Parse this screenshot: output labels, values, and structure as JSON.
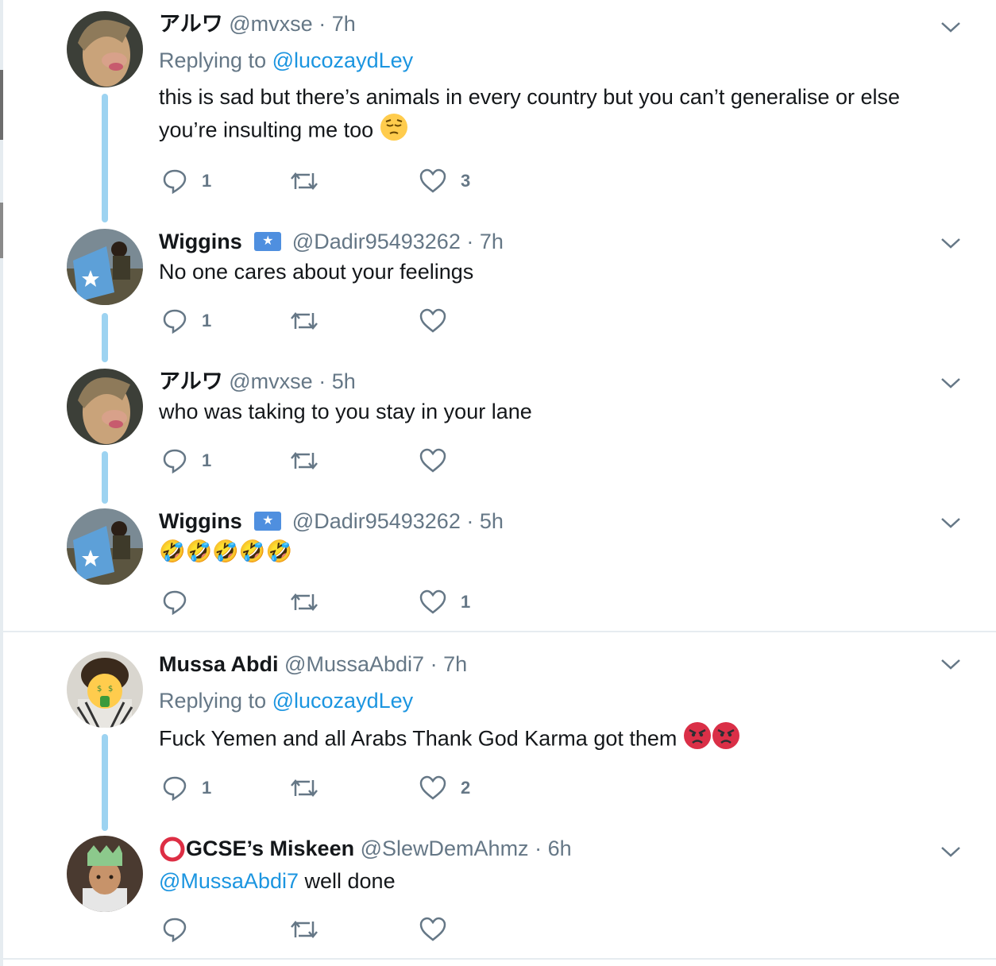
{
  "tweets": [
    {
      "name": "アルワ",
      "handle": "@mvxse",
      "dot": "·",
      "time": "7h",
      "replying_prefix": "Replying to",
      "replying_handle": "@lucozaydLey",
      "text_line1": "this is sad but there’s animals in every country but you can’t generalise or else",
      "text_line2": "you’re insulting me too",
      "reply_count": "1",
      "like_count": "3"
    },
    {
      "name": "Wiggins",
      "badge_flag": "★",
      "handle": "@Dadir95493262",
      "dot": "·",
      "time": "7h",
      "text": "No one cares about your feelings",
      "reply_count": "1"
    },
    {
      "name": "アルワ",
      "handle": "@mvxse",
      "dot": "·",
      "time": "5h",
      "text": "who was taking to you stay in your lane",
      "reply_count": "1"
    },
    {
      "name": "Wiggins",
      "badge_flag": "★",
      "handle": "@Dadir95493262",
      "dot": "·",
      "time": "5h",
      "text": "🤣🤣🤣🤣🤣",
      "like_count": "1"
    },
    {
      "name": "Mussa Abdi",
      "handle": "@MussaAbdi7",
      "dot": "·",
      "time": "7h",
      "replying_prefix": "Replying to",
      "replying_handle": "@lucozaydLey",
      "text": "Fuck Yemen and all Arabs Thank God Karma got them",
      "reply_count": "1",
      "like_count": "2"
    },
    {
      "name": "GCSE’s Miskeen",
      "handle": "@SlewDemAhmz",
      "dot": "·",
      "time": "6h",
      "mention": "@MussaAbdi7",
      "text": "well done"
    }
  ],
  "icons": {
    "reply": "reply-icon",
    "retweet": "retweet-icon",
    "like": "heart-icon",
    "more": "chevron-down-icon"
  },
  "colors": {
    "link": "#1b95e0",
    "thread_line": "#9dd3f1",
    "muted": "#657786",
    "badge": "#4f8fdf"
  }
}
